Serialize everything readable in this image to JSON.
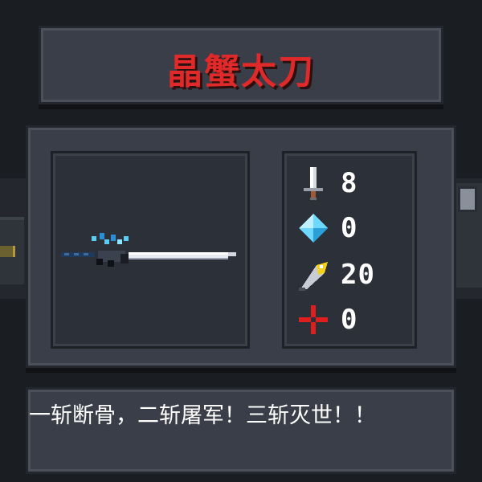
{
  "weapon": {
    "name": "晶蟹太刀",
    "name_color": "#e02a2a",
    "description": "一斩断骨，二斩屠军！三斩灭世！！"
  },
  "stats": [
    {
      "icon": "sword-icon",
      "label": "damage",
      "value": "8"
    },
    {
      "icon": "energy-crystal-icon",
      "label": "energy-cost",
      "value": "0"
    },
    {
      "icon": "crit-feather-icon",
      "label": "critical",
      "value": "20"
    },
    {
      "icon": "red-cross-icon",
      "label": "inaccuracy",
      "value": "0"
    }
  ],
  "colors": {
    "panel": "#3a3e48",
    "frame": "#2c3039",
    "text": "#ffffff"
  }
}
